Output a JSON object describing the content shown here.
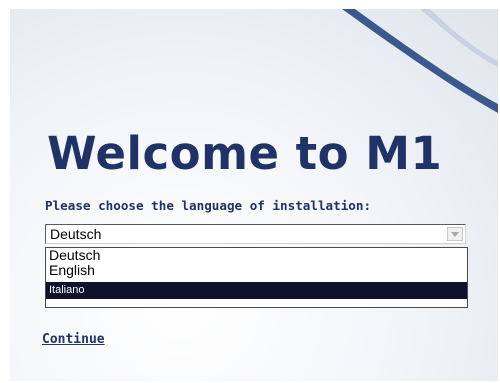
{
  "header": {
    "title": "Welcome to M1"
  },
  "form": {
    "prompt": "Please choose the language of installation:",
    "language_select": {
      "selected_value": "Deutsch",
      "options": [
        "Deutsch",
        "English",
        "Italiano"
      ],
      "highlighted_option": "Italiano"
    },
    "continue_link": "Continue"
  },
  "colors": {
    "title": "#1f3368",
    "highlight": "#11112e",
    "swoosh": "#3a5a8f"
  },
  "icons": {
    "dropdown": "chevron-down-icon"
  }
}
